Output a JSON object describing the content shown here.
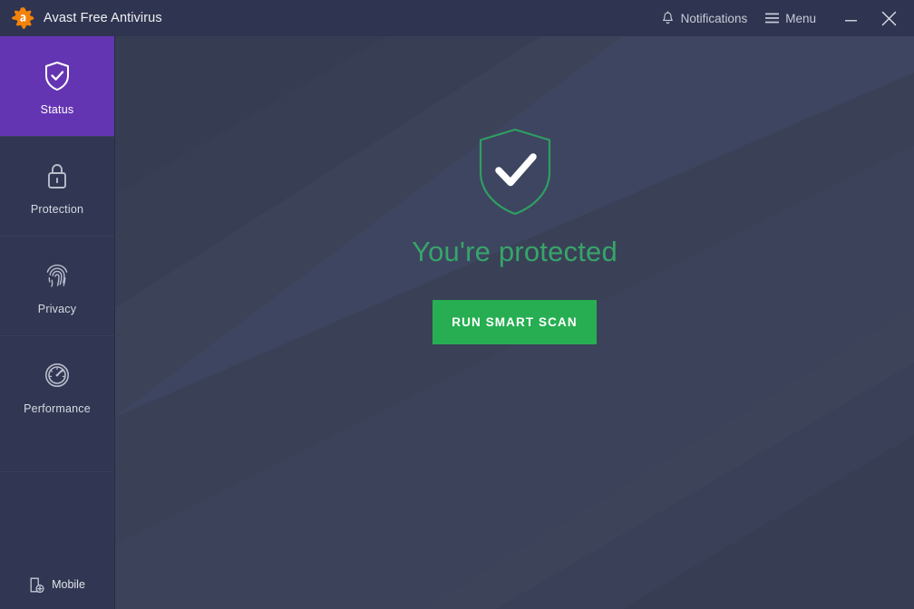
{
  "window": {
    "title": "Avast Free Antivirus",
    "logo_icon": "avast-logo-icon",
    "notifications_label": "Notifications",
    "notifications_icon": "bell-icon",
    "menu_label": "Menu",
    "menu_icon": "hamburger-icon",
    "minimize_icon": "minimize-icon",
    "close_icon": "close-icon"
  },
  "sidebar": {
    "items": [
      {
        "label": "Status",
        "icon": "shield-check-icon",
        "active": true
      },
      {
        "label": "Protection",
        "icon": "lock-icon",
        "active": false
      },
      {
        "label": "Privacy",
        "icon": "fingerprint-icon",
        "active": false
      },
      {
        "label": "Performance",
        "icon": "speedometer-icon",
        "active": false
      }
    ],
    "mobile": {
      "label": "Mobile",
      "icon": "mobile-add-icon"
    }
  },
  "main": {
    "status_icon": "shield-check-large-icon",
    "headline": "You're protected",
    "scan_button_label": "RUN SMART SCAN"
  },
  "colors": {
    "titlebar_bg": "#2f3450",
    "sidebar_bg": "#313752",
    "active_item_bg": "#6435b3",
    "main_bg": "#3b4259",
    "status_green": "#36a56a",
    "button_green": "#27ae52",
    "logo_orange": "#f2820a"
  }
}
